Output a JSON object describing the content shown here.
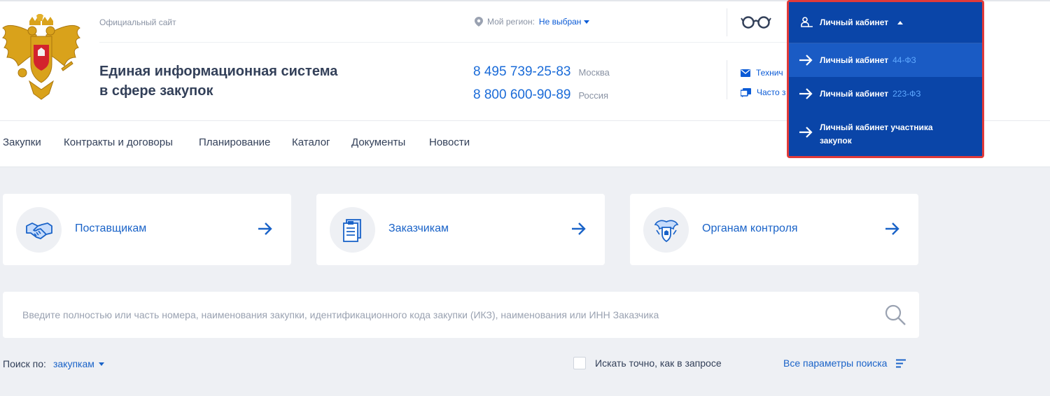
{
  "header": {
    "official_label": "Официальный сайт",
    "title_line1": "Единая информационная система",
    "title_line2": "в сфере закупок",
    "region_label": "Мой регион:",
    "region_value": "Не выбран",
    "phones": [
      {
        "number": "8 495 739-25-83",
        "city": "Москва"
      },
      {
        "number": "8 800 600-90-89",
        "city": "Россия"
      }
    ],
    "tech_links": [
      {
        "label": "Технич",
        "icon": "mail-icon"
      },
      {
        "label": "Часто з",
        "icon": "chat-icon"
      }
    ]
  },
  "nav": {
    "items": [
      "Закупки",
      "Контракты и договоры",
      "Планирование",
      "Каталог",
      "Документы",
      "Новости"
    ]
  },
  "roles": [
    {
      "label": "Поставщикам",
      "icon": "handshake-icon"
    },
    {
      "label": "Заказчикам",
      "icon": "document-icon"
    },
    {
      "label": "Органам контроля",
      "icon": "emblem-icon"
    }
  ],
  "search": {
    "placeholder": "Введите полностью или часть номера, наименования закупки, идентификационного кода закупки (ИКЗ), наименования или ИНН Заказчика",
    "by_label": "Поиск по:",
    "by_value": "закупкам",
    "exact_label": "Искать точно, как в запросе",
    "all_params": "Все параметры поиска"
  },
  "cabinet": {
    "label": "Личный кабинет",
    "items": [
      {
        "label": "Личный кабинет",
        "tag": "44-ФЗ"
      },
      {
        "label": "Личный кабинет",
        "tag": "223-ФЗ"
      },
      {
        "label_line1": "Личный кабинет участника",
        "label_line2": "закупок"
      }
    ]
  },
  "colors": {
    "accent": "#1a63c8",
    "dropdown_bg": "#0a45a8",
    "dropdown_active": "#1a5bc4",
    "highlight_border": "#e03a3a",
    "page_bg": "#eef0f4"
  }
}
